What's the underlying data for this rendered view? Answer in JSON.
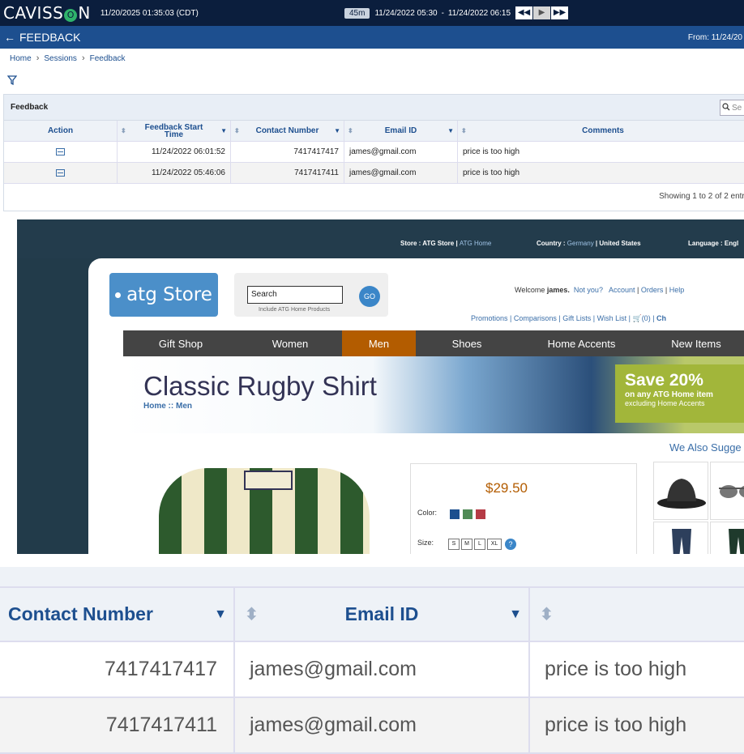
{
  "topbar": {
    "logo_pre": "CAVISS",
    "logo_o": "O",
    "logo_post": "N",
    "datetime": "11/20/2025 01:35:03 (CDT)",
    "duration": "45m",
    "range_start": "11/24/2022 05:30",
    "range_sep": "-",
    "range_end": "11/24/2022 06:15",
    "btn_rewind": "◀◀",
    "btn_play": "▶",
    "btn_forward": "▶▶"
  },
  "titlebar": {
    "back": "←",
    "title": "FEEDBACK",
    "from": "From: 11/24/20"
  },
  "breadcrumb": [
    "Home",
    "Sessions",
    "Feedback"
  ],
  "panel": {
    "title": "Feedback",
    "search_placeholder": "Se",
    "columns": [
      "Action",
      "Feedback Start Time",
      "Contact Number",
      "Email ID",
      "Comments"
    ],
    "rows": [
      {
        "time": "11/24/2022 06:01:52",
        "contact": "7417417417",
        "email": "james@gmail.com",
        "comment": "price is too high"
      },
      {
        "time": "11/24/2022 05:46:06",
        "contact": "7417417411",
        "email": "james@gmail.com",
        "comment": "price is too high"
      }
    ],
    "showing": "Showing 1 to 2 of 2 entri"
  },
  "replay": {
    "store_label": "Store : ATG Store",
    "store_link": "ATG Home",
    "country_label": "Country :",
    "country_val": "Germany",
    "country_alt": "United States",
    "language": "Language : Engl",
    "logo": "atg Store",
    "search": "Search",
    "search_go": "GO",
    "include": "Include ATG Home Products",
    "welcome": "Welcome",
    "user": "james.",
    "not_you": "Not you?",
    "account": "Account",
    "orders": "Orders",
    "help": "Help",
    "promotions": "Promotions",
    "comparisons": "Comparisons",
    "gift_lists": "Gift Lists",
    "wish_list": "Wish List",
    "cart": "(0)",
    "checkout": "Ch",
    "nav": [
      "Gift Shop",
      "Women",
      "Men",
      "Shoes",
      "Home Accents",
      "New Items"
    ],
    "product_title": "Classic Rugby Shirt",
    "product_crumb": "Home :: Men",
    "save_main": "Save 20%",
    "save_sub": "on any ATG Home item",
    "save_excl": "excluding Home Accents",
    "price": "$29.50",
    "color_label": "Color:",
    "size_label": "Size:",
    "sizes": [
      "S",
      "M",
      "L",
      "XL"
    ],
    "size_help": "?",
    "suggest": "We Also Sugge",
    "colors": [
      "#1b4f8f",
      "#4f8a55",
      "#b53b45"
    ]
  },
  "zoom": {
    "col_contact": "Contact Number",
    "col_email": "Email ID",
    "rows": [
      {
        "contact": "7417417417",
        "email": "james@gmail.com",
        "comment": "price is too high"
      },
      {
        "contact": "7417417411",
        "email": "james@gmail.com",
        "comment": "price is too high"
      }
    ]
  }
}
